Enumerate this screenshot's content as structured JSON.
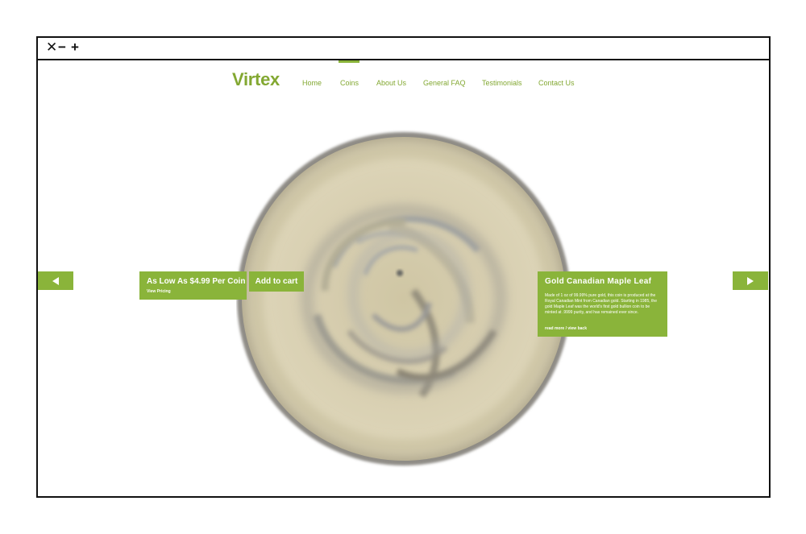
{
  "window": {
    "controls": {
      "close": "✕",
      "minimize": "−",
      "maximize": "+"
    }
  },
  "brand": {
    "logo": "Virtex",
    "accent_color": "#8ab43a"
  },
  "nav": {
    "items": [
      "Home",
      "Coins",
      "About Us",
      "General FAQ",
      "Testimonials",
      "Contact Us"
    ],
    "active": "Coins"
  },
  "slider": {
    "prev_icon": "left-arrow-icon",
    "next_icon": "right-arrow-icon"
  },
  "price_panel": {
    "title": "As Low As $4.99 Per Coin",
    "link": "View Pricing",
    "add_to_cart": "Add to cart"
  },
  "product": {
    "name": "Gold Canadian Maple Leaf",
    "description": "Made of 1 oz of 99.99% pure gold, this coin is produced at the Royal Canadian Mint from Canadian gold. Starting in 1985, the gold Maple Leaf was the world's first gold bullion coin to be minted at .9999 purity, and has remained ever since.",
    "link": "read more / view back"
  }
}
